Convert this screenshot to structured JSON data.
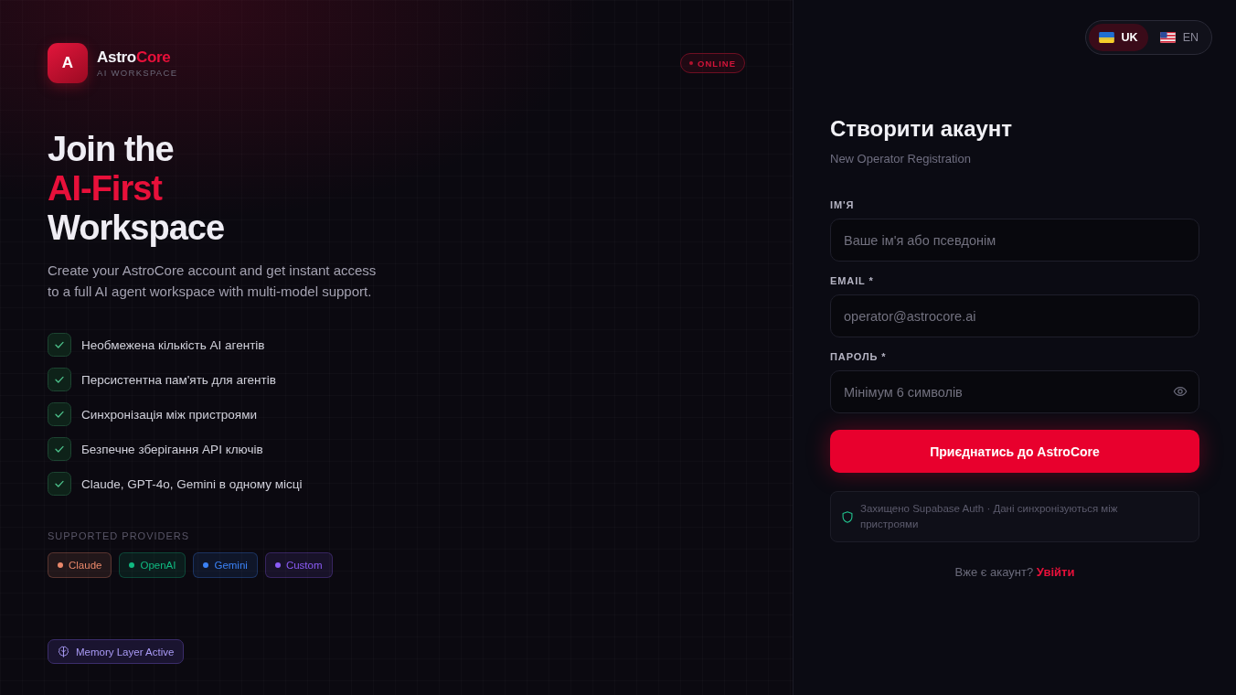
{
  "brand": {
    "logo_letter": "A",
    "name": "Astro",
    "name_accent": "Core",
    "tagline": "AI WORKSPACE"
  },
  "status_badge": {
    "label": "ONLINE"
  },
  "hero": {
    "headline": {
      "before": "Join the",
      "accent": "AI-First",
      "after": "Workspace"
    },
    "description": "Create your AstroCore account and get instant access to a full AI agent workspace with multi-model support."
  },
  "features": [
    {
      "label": "Необмежена кількість AI агентів",
      "checked": true
    },
    {
      "label": "Персистентна пам'ять для агентів",
      "checked": true
    },
    {
      "label": "Синхронізація між пристроями",
      "checked": true
    },
    {
      "label": "Безпечне зберігання API ключів",
      "checked": true
    },
    {
      "label": "Claude, GPT-4o, Gemini в одному місці",
      "checked": true
    }
  ],
  "providers": {
    "title": "SUPPORTED PROVIDERS",
    "items": [
      {
        "label": "Claude",
        "color": "#e8876a"
      },
      {
        "label": "OpenAI",
        "color": "#10b981"
      },
      {
        "label": "Gemini",
        "color": "#3b82f6"
      },
      {
        "label": "Custom",
        "color": "#8b5cf6"
      }
    ]
  },
  "memory_badge": {
    "label": "Memory Layer Active"
  },
  "language_switch": [
    {
      "code": "UK",
      "kind": "ukraine",
      "selected": true
    },
    {
      "code": "EN",
      "kind": "usa",
      "selected": false
    }
  ],
  "form": {
    "title": "Створити акаунт",
    "subtitle": "New Operator Registration",
    "fields": [
      {
        "label": "ІМ'Я",
        "placeholder": "Ваше ім'я або псевдонім",
        "kind": "text"
      },
      {
        "label": "EMAIL *",
        "placeholder": "operator@astrocore.ai",
        "kind": "email"
      },
      {
        "label": "ПАРОЛЬ *",
        "placeholder": "Мінімум 6 символів",
        "kind": "password"
      }
    ],
    "submit": "Приєднатись до AstroCore",
    "security_note": "Захищено Supabase Auth · Дані синхронізуються між пристроями",
    "login_prompt": "Вже є акаунт?",
    "login_link": "Увійти"
  }
}
